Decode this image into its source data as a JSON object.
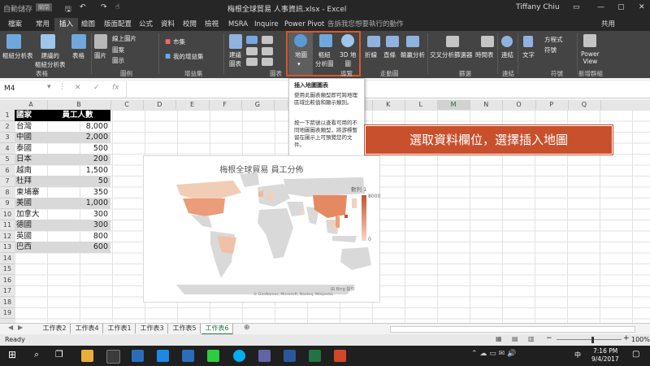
{
  "titlebar": {
    "autosave": "自動儲存",
    "autosave_state": "關閉",
    "title": "梅根全球貿易 人事資訊.xlsx  -  Excel",
    "user": "Tiffany Chiu"
  },
  "tabs": [
    "檔案",
    "常用",
    "插入",
    "繪圖",
    "版面配置",
    "公式",
    "資料",
    "校閱",
    "檢視",
    "MSRA",
    "Inquire",
    "Power Pivot"
  ],
  "tellme": "告訴我您想要執行的動作",
  "share": "共用",
  "ribbon": {
    "pivot": "樞紐分析表",
    "rec_pivot": "建議的\n樞紐分析表",
    "table": "表格",
    "pictures": "圖片",
    "online_pictures": "線上圖片",
    "shapes": "圖案",
    "icons": "圖示",
    "store": "市集",
    "my_addins": "我的增益集",
    "rec_charts": "建議\n圖表",
    "maps": "地圖",
    "pivotchart": "樞紐\n分析圖",
    "3dmap": "3D 地\n圖",
    "line": "折線",
    "column": "直條",
    "winloss": "輸贏分析",
    "slicer": "交叉分析篩選器",
    "timeline": "時間表",
    "link": "連結",
    "text": "文字",
    "equation": "方程式",
    "symbol": "符號",
    "powerview": "Power\nView",
    "groups": {
      "tables": "表格",
      "illustrations": "圖例",
      "addins": "增益集",
      "charts": "圖表",
      "tours": "導覽",
      "sparklines": "走動圖",
      "filters": "篩選",
      "links": "連結",
      "symbols": "符號",
      "reports": "新增群組"
    }
  },
  "namebox": "M4",
  "columns": [
    "A",
    "B",
    "C",
    "D",
    "E",
    "F",
    "G",
    "H",
    "I",
    "J",
    "K",
    "L",
    "M",
    "N",
    "O",
    "P",
    "Q"
  ],
  "selected_column": "M",
  "rows": [
    "1",
    "2",
    "3",
    "4",
    "5",
    "6",
    "7",
    "8",
    "9",
    "10",
    "11",
    "12",
    "13",
    "14",
    "15",
    "16",
    "17",
    "18",
    "19"
  ],
  "table": {
    "header": [
      "國家",
      "員工人數"
    ],
    "rows": [
      [
        "台灣",
        "8,000"
      ],
      [
        "中國",
        "2,000"
      ],
      [
        "泰國",
        "500"
      ],
      [
        "日本",
        "200"
      ],
      [
        "越南",
        "1,500"
      ],
      [
        "杜拜",
        "50"
      ],
      [
        "柬埔寨",
        "350"
      ],
      [
        "美國",
        "1,000"
      ],
      [
        "加拿大",
        "300"
      ],
      [
        "德國",
        "300"
      ],
      [
        "英國",
        "800"
      ],
      [
        "巴西",
        "600"
      ]
    ]
  },
  "tooltip": {
    "title": "插入地圖圖表",
    "p1": "使用此圖表類型即可跨地理區域比較值和顯示類別。",
    "p2": "按一下箭號以查看可用的不同地圖圖表類型，將游標暫留在圖示上可預覽您的文件。"
  },
  "callout": "選取資料欄位，選擇插入地圖",
  "chart": {
    "title": "梅根全球貿易 員工分佈",
    "legend_title": "數列 1",
    "legend_max": "8000",
    "legend_min": "0",
    "powered": "由 Bing 提供",
    "credit": "© GeoNames, Microsoft, Navteq, Wikipedia",
    "colors": {
      "high": "#c8502d",
      "low": "#f6d8c6",
      "none": "#d9d9d9"
    }
  },
  "sheets": [
    "工作表2",
    "工作表4",
    "工作表1",
    "工作表3",
    "工作表5",
    "工作表6"
  ],
  "active_sheet": "工作表6",
  "status": {
    "ready": "Ready",
    "zoom": "100%"
  },
  "taskbar": {
    "time": "7:16 PM",
    "date": "9/4/2017",
    "lang": "中"
  }
}
